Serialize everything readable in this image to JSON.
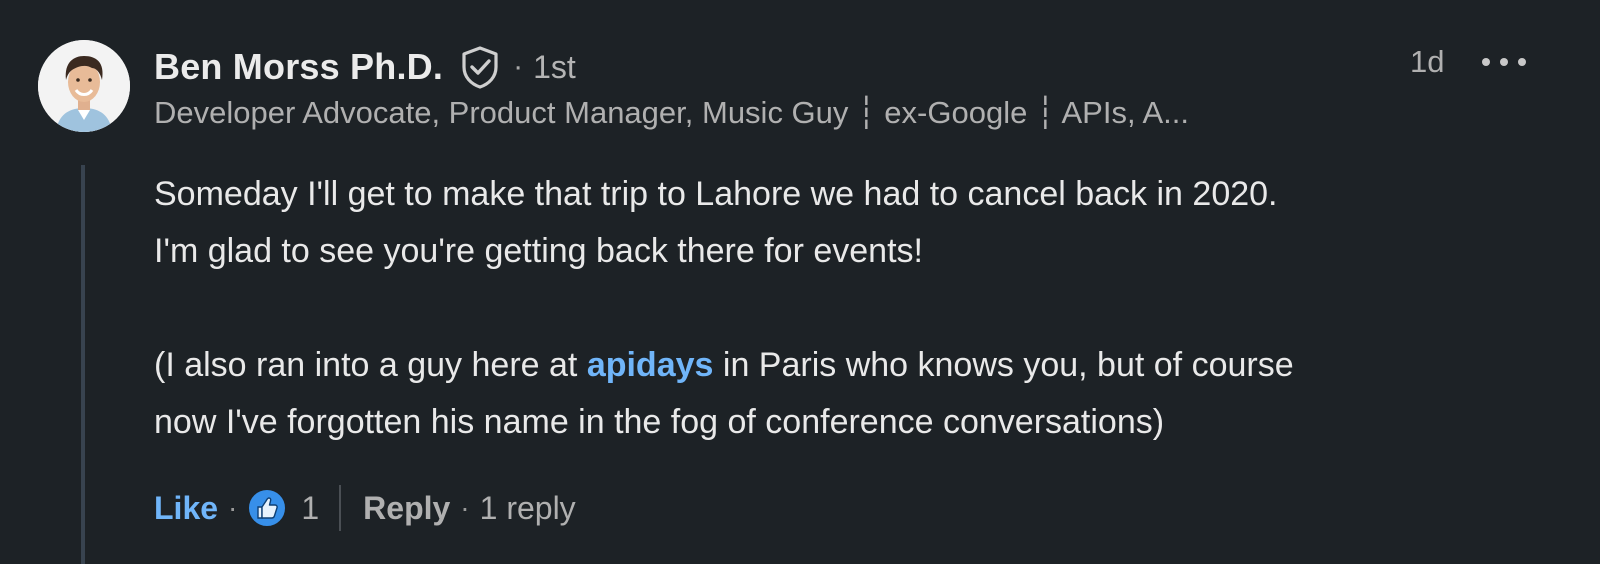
{
  "author": {
    "name": "Ben Morss Ph.D.",
    "separator": "·",
    "degree": "1st",
    "headline": "Developer Advocate, Product Manager, Music Guy ┆ ex-Google ┆ APIs, A..."
  },
  "meta": {
    "time": "1d"
  },
  "comment": {
    "line1": "Someday I'll get to make that trip to Lahore we had to cancel back in 2020.",
    "line2": "I'm glad to see you're getting back there for events!",
    "line3_before": "(I also ran into a guy here at ",
    "mention": "apidays",
    "line3_after": " in Paris who knows you, but of course",
    "line4": "now I've forgotten his name in the fog of conference conversations)"
  },
  "actions": {
    "like_label": "Like",
    "separator": "·",
    "reaction_count": "1",
    "reply_label": "Reply",
    "reply_count": "1 reply"
  },
  "icons": {
    "verified": "shield-check-icon",
    "more": "more-horizontal-icon",
    "reaction": "like-reaction-icon"
  },
  "colors": {
    "background": "#1d2226",
    "link_blue": "#70b5f9",
    "text_primary": "#e9e9e9",
    "text_secondary": "#b0b0b0"
  }
}
